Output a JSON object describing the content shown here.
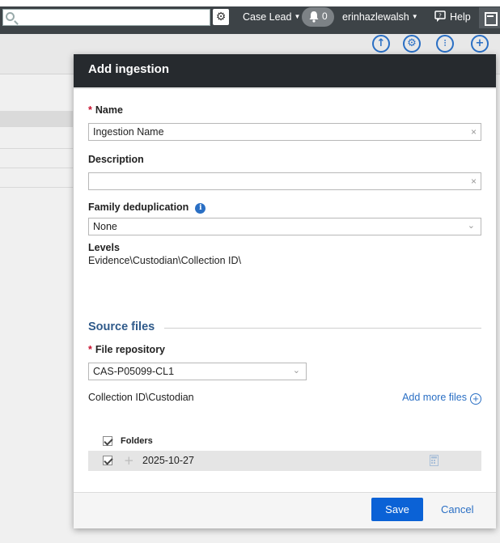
{
  "topbar": {
    "search_placeholder": "",
    "role": "Case Lead",
    "notification_count": "0",
    "username": "erinhazlewalsh",
    "help": "Help"
  },
  "modal": {
    "title": "Add ingestion",
    "required_mark": "*",
    "name_label": "Name",
    "name_value": "Ingestion Name",
    "description_label": "Description",
    "description_value": "",
    "dedup_label": "Family deduplication",
    "dedup_value": "None",
    "levels_label": "Levels",
    "levels_value": "Evidence\\Custodian\\Collection ID\\",
    "source_files_heading": "Source files",
    "repo_label": "File repository",
    "repo_value": "CAS-P05099-CL1",
    "path_text": "Collection ID\\Custodian",
    "add_more_files": "Add more files",
    "folders_header": "Folders",
    "folders": [
      {
        "name": "2025-10-27",
        "checked": true
      }
    ],
    "save": "Save",
    "cancel": "Cancel"
  },
  "colors": {
    "accent": "#0b62d6",
    "header_bg": "#262a2e",
    "required": "#c8102e"
  }
}
